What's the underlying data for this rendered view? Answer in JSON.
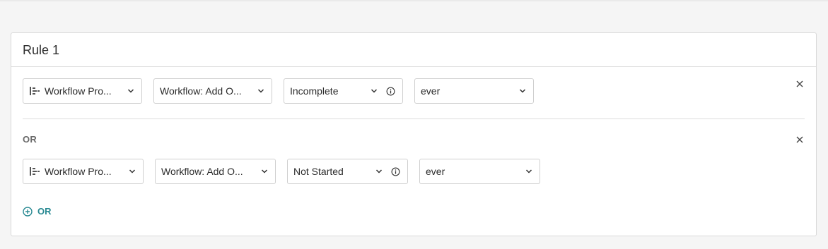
{
  "rule": {
    "title": "Rule 1",
    "conditions": [
      {
        "property": "Workflow Pro...",
        "workflow": "Workflow: Add O...",
        "status": "Incomplete",
        "time": "ever"
      },
      {
        "property": "Workflow Pro...",
        "workflow": "Workflow: Add O...",
        "status": "Not Started",
        "time": "ever"
      }
    ],
    "or_separator": "OR",
    "add_or_label": "OR"
  },
  "icons": [
    "property-list-icon",
    "chevron-down-icon",
    "info-icon",
    "close-icon",
    "plus-circle-icon"
  ],
  "colors": {
    "accent": "#2a8a93",
    "border": "#cfcfcf",
    "background": "#f5f5f5"
  }
}
